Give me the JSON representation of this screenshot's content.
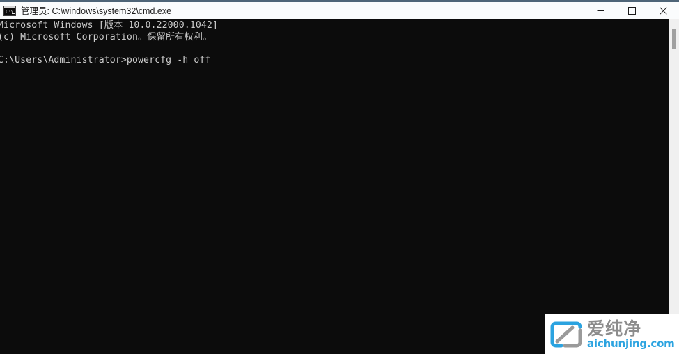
{
  "window": {
    "title": "管理员: C:\\windows\\system32\\cmd.exe",
    "icon": "cmd-icon",
    "icon_prompt_text": "C:\\",
    "background_color": "#0c0c0c",
    "titlebar_color": "#fafcfd",
    "titlebar_border_color": "#4e6578",
    "controls": [
      {
        "name": "minimize",
        "label": "最小化",
        "glyph": "minimize-icon"
      },
      {
        "name": "maximize",
        "label": "最大化",
        "glyph": "maximize-icon"
      },
      {
        "name": "close",
        "label": "关闭",
        "glyph": "close-icon"
      }
    ]
  },
  "console": {
    "text_color": "#cccccc",
    "lines": [
      "Microsoft Windows [版本 10.0.22000.1042]",
      "(c) Microsoft Corporation。保留所有权利。",
      "",
      "C:\\Users\\Administrator>powercfg -h off"
    ],
    "full_text": "Microsoft Windows [版本 10.0.22000.1042]\n(c) Microsoft Corporation。保留所有权利。\n\nC:\\Users\\Administrator>powercfg -h off",
    "prompt": "C:\\Users\\Administrator>",
    "command": "powercfg -h off",
    "os_name": "Microsoft Windows",
    "os_version": "10.0.22000.1042",
    "copyright": "(c) Microsoft Corporation。保留所有权利。"
  },
  "scrollbar": {
    "track_color": "#f0f0f0",
    "thumb_color": "#a0a0a0"
  },
  "watermark": {
    "chinese": "爱纯净",
    "url": "aichunjing.com",
    "chinese_color": "#8c8c8c",
    "url_color": "#2ba3e0",
    "logo_blue": "#2ba3e0",
    "logo_gray": "#9a9a9a"
  }
}
